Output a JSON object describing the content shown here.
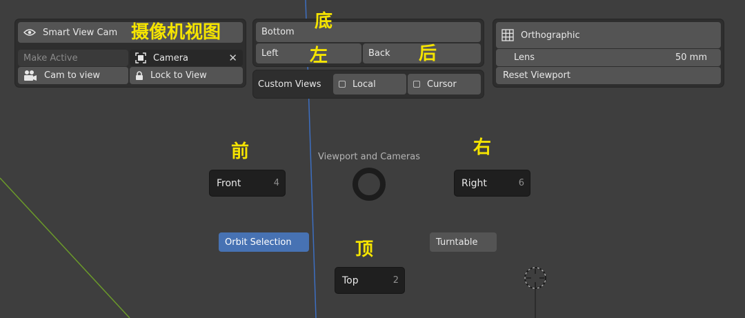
{
  "smart_view": {
    "smart_view_cam": "Smart View Cam",
    "make_active": "Make Active",
    "camera_value": "Camera",
    "cam_to_view": "Cam to view",
    "lock_to_view": "Lock to View",
    "annotation": "摄像机视图"
  },
  "views": {
    "bottom": "Bottom",
    "left": "Left",
    "back": "Back",
    "custom_views": "Custom Views",
    "local": "Local",
    "cursor": "Cursor",
    "annotation_bottom": "底",
    "annotation_left": "左",
    "annotation_back": "后"
  },
  "projection": {
    "orthographic": "Orthographic",
    "lens_label": "Lens",
    "lens_value": "50 mm",
    "reset_viewport": "Reset Viewport"
  },
  "pie": {
    "title": "Viewport and Cameras",
    "front": {
      "label": "Front",
      "key": "4",
      "annotation": "前"
    },
    "right": {
      "label": "Right",
      "key": "6",
      "annotation": "右"
    },
    "top": {
      "label": "Top",
      "key": "2",
      "annotation": "顶"
    },
    "orbit_selection": "Orbit Selection",
    "turntable": "Turntable"
  },
  "icons": [
    "eye-icon",
    "camera-frame-icon",
    "close-icon",
    "movie-camera-icon",
    "lock-icon",
    "grid-icon",
    "checkbox-icon",
    "pie-center-ring",
    "3d-cursor-icon"
  ],
  "colors": {
    "background": "#3e3e3e",
    "panel": "#2e2e2e",
    "button": "#545454",
    "accent_blue": "#4772b3",
    "annotation_yellow": "#f5e400",
    "axis_blue": "#3d6fc2",
    "axis_green": "#6b9a2a"
  }
}
